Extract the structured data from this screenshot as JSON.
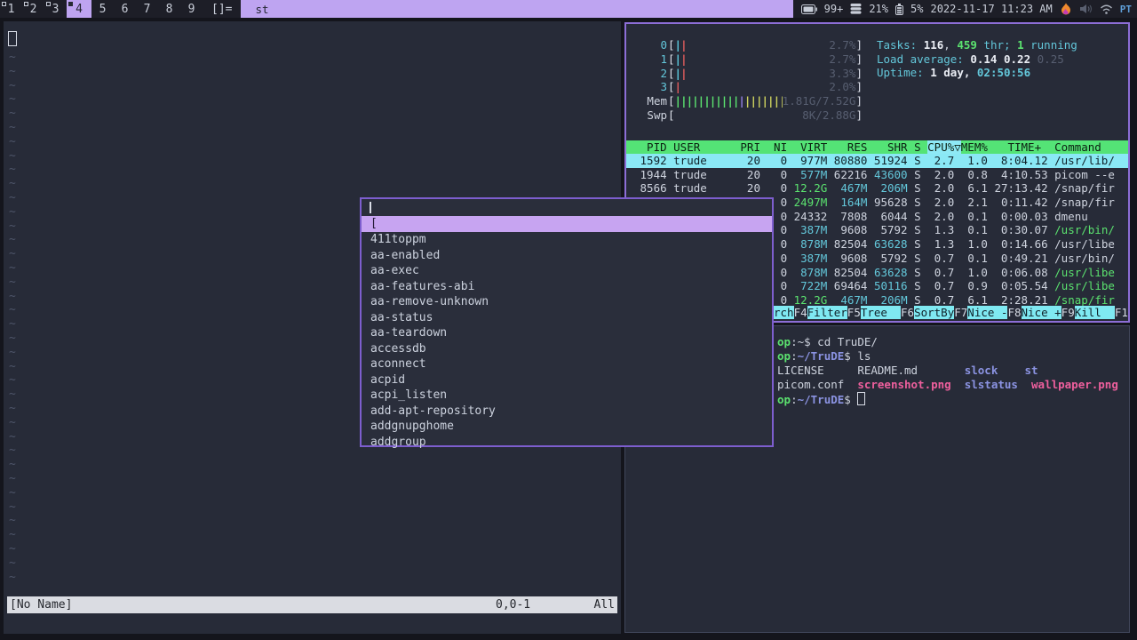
{
  "palette": {
    "bar_bg": "#1d1e27",
    "accent_lavender": "#bea4f1",
    "window_bg": "#272b38",
    "desktop_bg": "#14151c",
    "border_focused": "#8c6ed6",
    "border_dmenu": "#7d5ece",
    "border_unfocused": "#40465a",
    "htop_header_green": "#54e376",
    "htop_selected_cyan": "#8ae8f5",
    "fn_key_cyan": "#7fe9f2",
    "text_fg": "#ced3de",
    "text_cyan": "#63c7da",
    "text_green": "#5be26f",
    "bar_red": "#e05c5c",
    "bar_yellow": "#ced35f",
    "bar_purple": "#9180e2",
    "dir_blue": "#8b93e2",
    "image_pink": "#ee5f9d",
    "prompt_green": "#56d96a",
    "keyboard_blue": "#5f9fd8",
    "vim_statusbar_bg": "#dadce2"
  },
  "topbar": {
    "tags": [
      {
        "label": "1",
        "indicator": "outline",
        "active": false
      },
      {
        "label": "2",
        "indicator": "outline",
        "active": false
      },
      {
        "label": "3",
        "indicator": "outline",
        "active": false
      },
      {
        "label": "4",
        "indicator": "filled",
        "active": true
      },
      {
        "label": "5",
        "indicator": "none",
        "active": false
      },
      {
        "label": "6",
        "indicator": "none",
        "active": false
      },
      {
        "label": "7",
        "indicator": "none",
        "active": false
      },
      {
        "label": "8",
        "indicator": "none",
        "active": false
      },
      {
        "label": "9",
        "indicator": "none",
        "active": false
      }
    ],
    "layout_symbol": "[]=",
    "window_title": "st",
    "status": {
      "battery_badge": "99+",
      "disk_percent": "21%",
      "battery_percent": "5%",
      "datetime": "2022-11-17 11:23 AM",
      "tray_icons": [
        "flame-icon",
        "volume-icon",
        "wifi-icon"
      ],
      "keyboard_layout": "PT"
    }
  },
  "vim": {
    "tilde": "~",
    "tilde_count": 38,
    "statusline": {
      "filename": "[No Name]",
      "position": "0,0-1",
      "scroll": "All"
    }
  },
  "htop": {
    "meters": {
      "cpus": [
        {
          "label": "0",
          "bars": [
            "cyan",
            "red"
          ],
          "value": "2.7%"
        },
        {
          "label": "1",
          "bars": [
            "cyan",
            "red"
          ],
          "value": "2.7%"
        },
        {
          "label": "2",
          "bars": [
            "cyan",
            "red"
          ],
          "value": "3.3%"
        },
        {
          "label": "3",
          "bars": [
            "red"
          ],
          "value": "2.0%"
        }
      ],
      "mem": {
        "label": "Mem",
        "bars": [
          "green",
          "green",
          "green",
          "green",
          "green",
          "green",
          "green",
          "green",
          "green",
          "green",
          "green",
          "purple",
          "yellow",
          "yellow",
          "yellow",
          "yellow",
          "yellow",
          "yellow",
          "yellow",
          "yellow"
        ],
        "value": "1.81G/7.52G"
      },
      "swp": {
        "label": "Swp",
        "bars": [],
        "value": "8K/2.88G"
      }
    },
    "info": {
      "tasks": [
        [
          "Tasks: ",
          "cyan"
        ],
        [
          "116",
          "whiteb"
        ],
        [
          ", ",
          "fg"
        ],
        [
          "459",
          "greenb"
        ],
        [
          " thr; ",
          "cyan"
        ],
        [
          "1",
          "greenb"
        ],
        [
          " running",
          "cyan"
        ]
      ],
      "load": [
        [
          "Load average: ",
          "cyan"
        ],
        [
          "0.14 ",
          "whiteb"
        ],
        [
          "0.22 ",
          "whiteb"
        ],
        [
          "0.25",
          "dim"
        ]
      ],
      "uptime": [
        [
          "Uptime: ",
          "cyan"
        ],
        [
          "1 day, ",
          "whiteb"
        ],
        [
          "02:50:56",
          "cyanb"
        ]
      ]
    },
    "table_header": [
      [
        "  PID USER      PRI  NI  VIRT   RES   SHR S ",
        "h"
      ],
      [
        "CPU%▽",
        "hs"
      ],
      [
        "MEM%   TIME+  Command",
        "h"
      ]
    ],
    "rows": [
      {
        "selected": true,
        "segs": [
          [
            " 1592 trude      20   0  977M 80880 51924 S  2.7  1.0  8:04.12 /usr/lib/",
            "fg"
          ]
        ]
      },
      {
        "selected": false,
        "segs": [
          [
            " 1944 trude      20   0  ",
            "fg"
          ],
          [
            "577M",
            "cyan"
          ],
          [
            " 62216 ",
            "fg"
          ],
          [
            "43600",
            "cyan"
          ],
          [
            " S  2.0  0.8  4:10.53 picom --e",
            "fg"
          ]
        ]
      },
      {
        "selected": false,
        "segs": [
          [
            " 8566 trude      20   0 ",
            "fg"
          ],
          [
            "12.2G",
            "green"
          ],
          [
            "  ",
            "fg"
          ],
          [
            "467M",
            "cyan"
          ],
          [
            "  ",
            "fg"
          ],
          [
            "206M",
            "cyan"
          ],
          [
            " S  2.0  6.1 27:13.42 /snap/fir",
            "fg"
          ]
        ]
      },
      {
        "selected": false,
        "segs": [
          [
            "                      0 ",
            "fg"
          ],
          [
            "2497M",
            "green"
          ],
          [
            "  ",
            "fg"
          ],
          [
            "164M",
            "cyan"
          ],
          [
            " 95628 S  2.0  2.1  0:11.42 /snap/fir",
            "fg"
          ]
        ]
      },
      {
        "selected": false,
        "segs": [
          [
            "                      0 24332  7808  6044 S  2.0  0.1  0:00.03 dmenu",
            "fg"
          ]
        ]
      },
      {
        "selected": false,
        "segs": [
          [
            "                      0  ",
            "fg"
          ],
          [
            "387M",
            "cyan"
          ],
          [
            "  9608  5792 S  1.3  0.1  0:30.07 ",
            "fg"
          ],
          [
            "/usr/bin/",
            "green"
          ]
        ]
      },
      {
        "selected": false,
        "segs": [
          [
            "                      0  ",
            "fg"
          ],
          [
            "878M",
            "cyan"
          ],
          [
            " 82504 ",
            "fg"
          ],
          [
            "63628",
            "cyan"
          ],
          [
            " S  1.3  1.0  0:14.66 /usr/libe",
            "fg"
          ]
        ]
      },
      {
        "selected": false,
        "segs": [
          [
            "                      0  ",
            "fg"
          ],
          [
            "387M",
            "cyan"
          ],
          [
            "  9608  5792 S  0.7  0.1  0:49.21 /usr/bin/",
            "fg"
          ]
        ]
      },
      {
        "selected": false,
        "segs": [
          [
            "                      0  ",
            "fg"
          ],
          [
            "878M",
            "cyan"
          ],
          [
            " 82504 ",
            "fg"
          ],
          [
            "63628",
            "cyan"
          ],
          [
            " S  0.7  1.0  0:06.08 ",
            "fg"
          ],
          [
            "/usr/libe",
            "green"
          ]
        ]
      },
      {
        "selected": false,
        "segs": [
          [
            "                      0  ",
            "fg"
          ],
          [
            "722M",
            "cyan"
          ],
          [
            " 69464 ",
            "fg"
          ],
          [
            "50116",
            "cyan"
          ],
          [
            " S  0.7  0.9  0:05.54 ",
            "fg"
          ],
          [
            "/usr/libe",
            "green"
          ]
        ]
      },
      {
        "selected": false,
        "segs": [
          [
            "                      0 ",
            "fg"
          ],
          [
            "12.2G",
            "green"
          ],
          [
            "  ",
            "fg"
          ],
          [
            "467M",
            "cyan"
          ],
          [
            "  ",
            "fg"
          ],
          [
            "206M",
            "cyan"
          ],
          [
            " S  0.7  6.1  2:28.21 ",
            "fg"
          ],
          [
            "/snap/fir",
            "green"
          ]
        ]
      }
    ],
    "fnbar": [
      [
        "rch",
        "klabel"
      ],
      [
        "F4",
        "key"
      ],
      [
        "Filter",
        "klabel"
      ],
      [
        "F5",
        "key"
      ],
      [
        "Tree  ",
        "klabel"
      ],
      [
        "F6",
        "key"
      ],
      [
        "SortBy",
        "klabel"
      ],
      [
        "F7",
        "key"
      ],
      [
        "Nice -",
        "klabel"
      ],
      [
        "F8",
        "key"
      ],
      [
        "Nice +",
        "klabel"
      ],
      [
        "F9",
        "key"
      ],
      [
        "Kill  ",
        "klabel"
      ],
      [
        "F1",
        "key"
      ]
    ]
  },
  "terminal": {
    "lines": [
      {
        "segs": [
          [
            "op",
            "greenb"
          ],
          [
            ":~$ ",
            "fg"
          ],
          [
            "cd TruDE/",
            "fg"
          ]
        ],
        "cursor": false
      },
      {
        "segs": [
          [
            "op",
            "greenb"
          ],
          [
            ":",
            "fg"
          ],
          [
            "~/TruDE",
            "blueb"
          ],
          [
            "$ ",
            "fg"
          ],
          [
            "ls",
            "fg"
          ]
        ],
        "cursor": false
      },
      {
        "segs": [
          [
            "LICENSE     ",
            "fg"
          ],
          [
            "README.md",
            "fg"
          ],
          [
            "       ",
            "fg"
          ],
          [
            "slock",
            "blueb"
          ],
          [
            "    ",
            "fg"
          ],
          [
            "st",
            "blueb"
          ]
        ],
        "cursor": false
      },
      {
        "segs": [
          [
            "picom.conf  ",
            "fg"
          ],
          [
            "screenshot.png",
            "pinkb"
          ],
          [
            "  ",
            "fg"
          ],
          [
            "slstatus",
            "blueb"
          ],
          [
            "  ",
            "fg"
          ],
          [
            "wallpaper.png",
            "pinkb"
          ]
        ],
        "cursor": false
      },
      {
        "segs": [
          [
            "op",
            "greenb"
          ],
          [
            ":",
            "fg"
          ],
          [
            "~/TruDE",
            "blueb"
          ],
          [
            "$ ",
            "fg"
          ]
        ],
        "cursor": true
      }
    ]
  },
  "dmenu": {
    "input_value": "",
    "selected": "[",
    "items": [
      "411toppm",
      "aa-enabled",
      "aa-exec",
      "aa-features-abi",
      "aa-remove-unknown",
      "aa-status",
      "aa-teardown",
      "accessdb",
      "aconnect",
      "acpid",
      "acpi_listen",
      "add-apt-repository",
      "addgnupghome",
      "addgroup"
    ]
  }
}
